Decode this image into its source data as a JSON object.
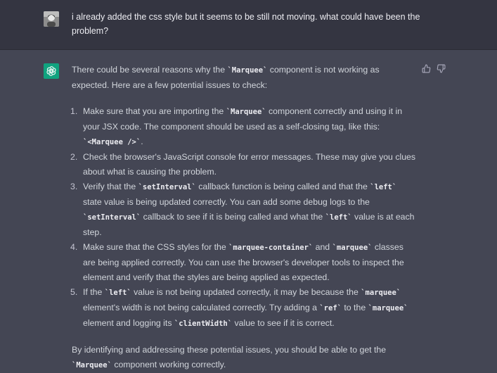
{
  "user_message": {
    "text": "i already added the css style but it seems to be still not moving. what could have been the problem?"
  },
  "assistant_message": {
    "intro": [
      {
        "t": "There could be several reasons why the "
      },
      {
        "c": "`Marquee`"
      },
      {
        "t": " component is not working as expected. Here are a few potential issues to check:"
      }
    ],
    "items": [
      {
        "num": "1.",
        "parts": [
          {
            "t": "Make sure that you are importing the "
          },
          {
            "c": "`Marquee`"
          },
          {
            "t": " component correctly and using it in your JSX code. The component should be used as a self-closing tag, like this: "
          },
          {
            "c": "`<Marquee />`"
          },
          {
            "t": "."
          }
        ]
      },
      {
        "num": "2.",
        "parts": [
          {
            "t": "Check the browser's JavaScript console for error messages. These may give you clues about what is causing the problem."
          }
        ]
      },
      {
        "num": "3.",
        "parts": [
          {
            "t": "Verify that the "
          },
          {
            "c": "`setInterval`"
          },
          {
            "t": " callback function is being called and that the "
          },
          {
            "c": "`left`"
          },
          {
            "t": " state value is being updated correctly. You can add some debug logs to the "
          },
          {
            "c": "`setInterval`"
          },
          {
            "t": " callback to see if it is being called and what the "
          },
          {
            "c": "`left`"
          },
          {
            "t": " value is at each step."
          }
        ]
      },
      {
        "num": "4.",
        "parts": [
          {
            "t": "Make sure that the CSS styles for the "
          },
          {
            "c": "`marquee-container`"
          },
          {
            "t": " and "
          },
          {
            "c": "`marquee`"
          },
          {
            "t": " classes are being applied correctly. You can use the browser's developer tools to inspect the element and verify that the styles are being applied as expected."
          }
        ]
      },
      {
        "num": "5.",
        "parts": [
          {
            "t": "If the "
          },
          {
            "c": "`left`"
          },
          {
            "t": " value is not being updated correctly, it may be because the "
          },
          {
            "c": "`marquee`"
          },
          {
            "t": " element's width is not being calculated correctly. Try adding a "
          },
          {
            "c": "`ref`"
          },
          {
            "t": " to the "
          },
          {
            "c": "`marquee`"
          },
          {
            "t": " element and logging its "
          },
          {
            "c": "`clientWidth`"
          },
          {
            "t": " value to see if it is correct."
          }
        ]
      }
    ],
    "outro": [
      {
        "t": "By identifying and addressing these potential issues, you should be able to get the "
      },
      {
        "c": "`Marquee`"
      },
      {
        "t": " component working correctly."
      }
    ]
  },
  "icons": {
    "user_avatar": "user-avatar-photo",
    "assistant_avatar": "openai-logo-icon",
    "thumbs_up": "thumbs-up-icon",
    "thumbs_down": "thumbs-down-icon"
  },
  "colors": {
    "user_row_bg": "#343541",
    "assistant_row_bg": "#444654",
    "assistant_avatar_bg": "#10a37f",
    "text": "#d1d5db"
  }
}
